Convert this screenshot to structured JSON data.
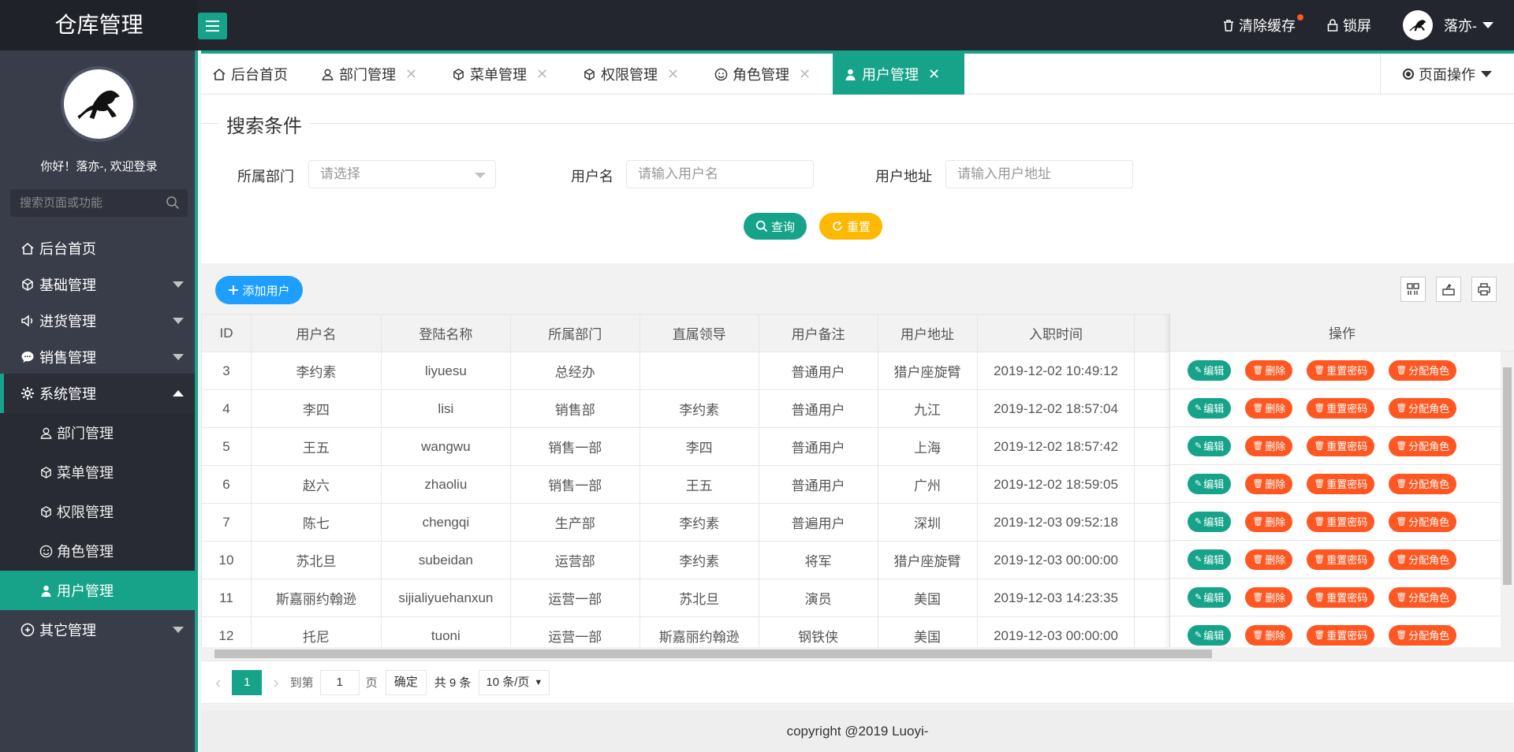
{
  "colors": {
    "accent": "#16a38a",
    "header_bg": "#23262e",
    "sidebar_bg": "#393d49",
    "warn": "#ffb800",
    "danger": "#ff5722",
    "info": "#1e9fff"
  },
  "header": {
    "title": "仓库管理",
    "clear_cache": "清除缓存",
    "lock_screen": "锁屏",
    "username": "落亦-"
  },
  "sidebar": {
    "welcome": "你好！落亦-, 欢迎登录",
    "search_placeholder": "搜索页面或功能",
    "items": [
      {
        "label": "后台首页",
        "icon": "home-icon"
      },
      {
        "label": "基础管理",
        "icon": "cube-icon"
      },
      {
        "label": "进货管理",
        "icon": "speaker-icon"
      },
      {
        "label": "销售管理",
        "icon": "chat-icon"
      },
      {
        "label": "系统管理",
        "icon": "gear-icon"
      },
      {
        "label": "其它管理",
        "icon": "other-icon"
      }
    ],
    "sub_items": [
      {
        "label": "部门管理"
      },
      {
        "label": "菜单管理"
      },
      {
        "label": "权限管理"
      },
      {
        "label": "角色管理"
      },
      {
        "label": "用户管理"
      }
    ]
  },
  "tabs": [
    {
      "label": "后台首页"
    },
    {
      "label": "部门管理"
    },
    {
      "label": "菜单管理"
    },
    {
      "label": "权限管理"
    },
    {
      "label": "角色管理"
    },
    {
      "label": "用户管理"
    }
  ],
  "page_ops": "页面操作",
  "search": {
    "legend": "搜索条件",
    "dept_label": "所属部门",
    "dept_placeholder": "请选择",
    "name_label": "用户名",
    "name_placeholder": "请输入用户名",
    "addr_label": "用户地址",
    "addr_placeholder": "请输入用户地址",
    "query": "查询",
    "reset": "重置"
  },
  "table": {
    "add_user": "添加用户",
    "columns": [
      "ID",
      "用户名",
      "登陆名称",
      "所属部门",
      "直属领导",
      "用户备注",
      "用户地址",
      "入职时间"
    ],
    "ops_header": "操作",
    "ops": {
      "edit": "编辑",
      "delete": "删除",
      "reset_pwd": "重置密码",
      "assign_role": "分配角色"
    },
    "rows": [
      [
        "3",
        "李约素",
        "liyuesu",
        "总经办",
        "",
        "普通用户",
        "猎户座旋臂",
        "2019-12-02 10:49:12"
      ],
      [
        "4",
        "李四",
        "lisi",
        "销售部",
        "李约素",
        "普通用户",
        "九江",
        "2019-12-02 18:57:04"
      ],
      [
        "5",
        "王五",
        "wangwu",
        "销售一部",
        "李四",
        "普通用户",
        "上海",
        "2019-12-02 18:57:42"
      ],
      [
        "6",
        "赵六",
        "zhaoliu",
        "销售一部",
        "王五",
        "普通用户",
        "广州",
        "2019-12-02 18:59:05"
      ],
      [
        "7",
        "陈七",
        "chengqi",
        "生产部",
        "李约素",
        "普遍用户",
        "深圳",
        "2019-12-03 09:52:18"
      ],
      [
        "10",
        "苏北旦",
        "subeidan",
        "运营部",
        "李约素",
        "将军",
        "猎户座旋臂",
        "2019-12-03 00:00:00"
      ],
      [
        "11",
        "斯嘉丽约翰逊",
        "sijialiyuehanxun",
        "运营一部",
        "苏北旦",
        "演员",
        "美国",
        "2019-12-03 14:23:35"
      ],
      [
        "12",
        "托尼",
        "tuoni",
        "运营一部",
        "斯嘉丽约翰逊",
        "钢铁侠",
        "美国",
        "2019-12-03 00:00:00"
      ]
    ]
  },
  "pager": {
    "current": "1",
    "goto": "到第",
    "page_input": "1",
    "page_unit": "页",
    "confirm": "确定",
    "total": "共 9 条",
    "size": "10 条/页"
  },
  "footer": "copyright @2019 Luoyi-"
}
